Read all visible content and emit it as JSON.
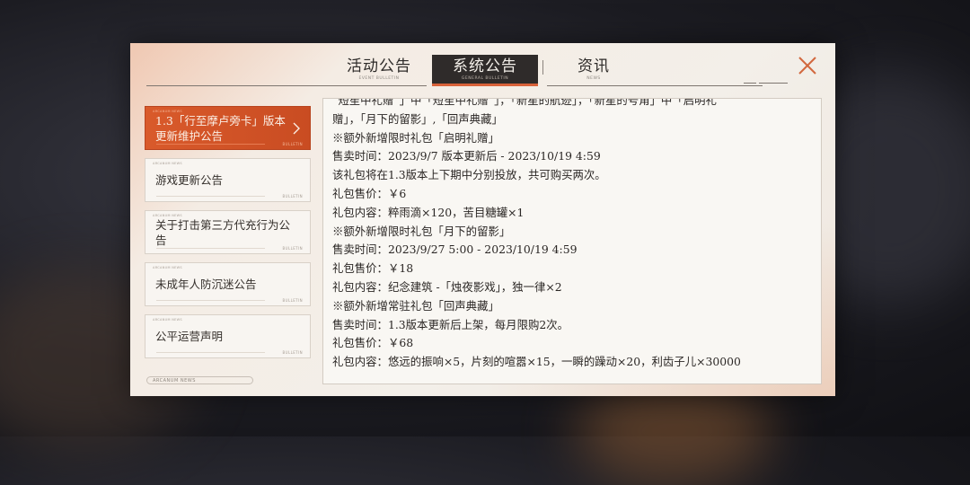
{
  "tabs": [
    {
      "label": "活动公告",
      "sub": "EVENT BULLETIN",
      "active": false
    },
    {
      "label": "系统公告",
      "sub": "GENERAL BULLETIN",
      "active": true
    },
    {
      "label": "资讯",
      "sub": "NEWS",
      "active": false
    }
  ],
  "sidebar": {
    "items": [
      {
        "label": "1.3「行至摩卢旁卡」版本更新维护公告",
        "mini_left": "ARCANUM NEWS",
        "mini_right": "BULLETIN",
        "active": true
      },
      {
        "label": "游戏更新公告",
        "mini_left": "ARCANUM NEWS",
        "mini_right": "BULLETIN",
        "active": false
      },
      {
        "label": "关于打击第三方代充行为公告",
        "mini_left": "ARCANUM NEWS",
        "mini_right": "BULLETIN",
        "active": false
      },
      {
        "label": "未成年人防沉迷公告",
        "mini_left": "ARCANUM NEWS",
        "mini_right": "BULLETIN",
        "active": false
      },
      {
        "label": "公平运营声明",
        "mini_left": "ARCANUM NEWS",
        "mini_right": "BULLETIN",
        "active": false
      }
    ],
    "footer": "ARCANUM NEWS"
  },
  "content": {
    "lines": [
      "“短笙中礼赠”」中「短笙中礼赠”」，「新星的航迹」，「新星的号角」中「启明礼",
      "赠」，「月下的留影」,「回声典藏」",
      "※额外新增限时礼包「启明礼赠」",
      "售卖时间：2023/9/7 版本更新后 - 2023/10/19 4:59",
      "该礼包将在1.3版本上下期中分别投放，共可购买两次。",
      "礼包售价：￥6",
      "礼包内容：粹雨滴×120，苦目糖罐×1",
      "※额外新增限时礼包「月下的留影」",
      "售卖时间：2023/9/27 5:00 - 2023/10/19 4:59",
      "礼包售价：￥18",
      "礼包内容：纪念建筑 -「烛夜影戏」，独一律×2",
      "※额外新增常驻礼包「回声典藏」",
      "售卖时间：1.3版本更新后上架，每月限购2次。",
      "礼包售价：￥68",
      "礼包内容：悠远的振响×5，片刻的喧嚣×15，一瞬的躁动×20，利齿子儿×30000"
    ]
  },
  "icons": {
    "close": "close-icon",
    "chevron": "chevron-right-icon"
  },
  "colors": {
    "accent": "#d95a2b",
    "tab_active_bg": "#2f2b2a",
    "text": "#2b2725"
  }
}
